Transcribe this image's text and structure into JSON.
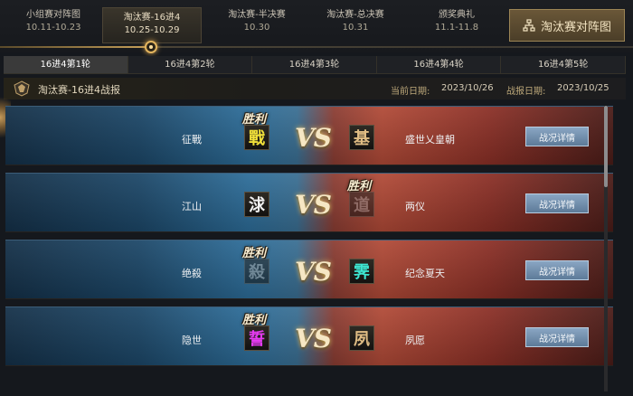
{
  "stages": [
    {
      "title": "小组赛对阵图",
      "dates": "10.11-10.23"
    },
    {
      "title": "淘汰赛-16进4",
      "dates": "10.25-10.29"
    },
    {
      "title": "淘汰赛-半决赛",
      "dates": "10.30"
    },
    {
      "title": "淘汰赛-总决赛",
      "dates": "10.31"
    },
    {
      "title": "颁奖典礼",
      "dates": "11.1-11.8"
    }
  ],
  "bracket_button": "淘汰赛对阵图",
  "tabs": [
    "16进4第1轮",
    "16进4第2轮",
    "16进4第3轮",
    "16进4第4轮",
    "16进4第5轮"
  ],
  "report": {
    "title": "淘汰赛-16进4战报",
    "current_date_label": "当前日期:",
    "current_date": "2023/10/26",
    "report_date_label": "战报日期:",
    "report_date": "2023/10/25"
  },
  "vs_text": "VS",
  "win_label": "胜利",
  "detail_label": "战况详情",
  "matches": [
    {
      "left_team": "征戰",
      "left_badge": "戰",
      "left_color": "#f3e23a",
      "right_team": "盛世乂皇朝",
      "right_badge": "基",
      "right_color": "#e0bd84",
      "winner": "left"
    },
    {
      "left_team": "江山",
      "left_badge": "浗",
      "left_color": "#f2f2f2",
      "right_team": "两仪",
      "right_badge": "道",
      "right_color": "#8e8e8e",
      "winner": "right"
    },
    {
      "left_team": "绝殺",
      "left_badge": "殺",
      "left_color": "#a8a49a",
      "right_team": "纪念夏天",
      "right_badge": "霁",
      "right_color": "#3ee6d2",
      "winner": "left"
    },
    {
      "left_team": "隐世",
      "left_badge": "誓",
      "left_color": "#e53bf0",
      "right_team": "夙愿",
      "right_badge": "夙",
      "right_color": "#e0bd84",
      "winner": "left"
    }
  ],
  "colors": {
    "accent": "#c9a25a",
    "detail_button": "#6f8cab"
  }
}
